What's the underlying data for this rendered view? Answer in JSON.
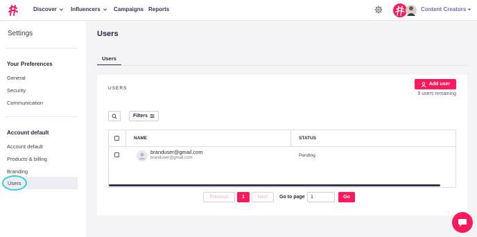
{
  "nav": {
    "discover": "Discover",
    "influencers": "Influencers",
    "campaigns": "Campaigns",
    "reports": "Reports",
    "account_menu": "Content Creators"
  },
  "sidebar": {
    "title": "Settings",
    "preferences_heading": "Your Preferences",
    "preferences_items": [
      {
        "label": "General"
      },
      {
        "label": "Security"
      },
      {
        "label": "Communication"
      }
    ],
    "account_heading": "Account default",
    "account_items": [
      {
        "label": "Account default"
      },
      {
        "label": "Products & billing"
      },
      {
        "label": "Branding"
      },
      {
        "label": "Users",
        "active": true
      }
    ]
  },
  "main": {
    "title": "Users",
    "tabs": [
      {
        "label": "Users",
        "active": true
      }
    ],
    "card": {
      "section_label": "USERS",
      "add_user_label": "Add user",
      "remaining": "9 users remaining",
      "filters_label": "Filters",
      "table": {
        "columns": [
          "NAME",
          "STATUS"
        ],
        "rows": [
          {
            "name": "branduser@gmail.com",
            "email": "branduser@gmail.com",
            "status": "Pending"
          }
        ]
      },
      "pagination": {
        "previous": "Previous",
        "current_page": "1",
        "next": "Next",
        "goto_label": "Go to page",
        "goto_value": "1",
        "go_label": "Go"
      }
    }
  },
  "colors": {
    "accent": "#ff1a5e",
    "nav_text": "#3a3350",
    "highlight_ring": "#2ad4e0"
  },
  "icons": {
    "logo": "brand-logo-icon",
    "settings": "gear-icon",
    "search": "search-icon",
    "filters": "filter-lines-icon",
    "add_user": "user-icon",
    "chat": "chat-icon"
  }
}
